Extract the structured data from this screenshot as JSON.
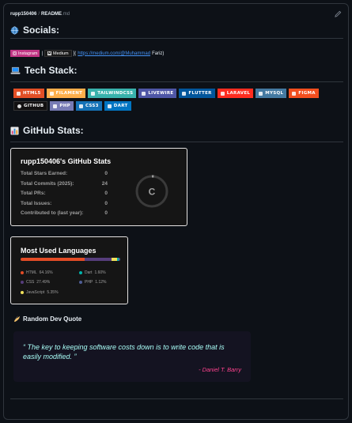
{
  "file": {
    "repo": "rupp150406",
    "separator": "/",
    "name": "README",
    "ext": ".md"
  },
  "socials": {
    "heading": "Socials:",
    "instagram_label": "Instagram",
    "separator": "|",
    "medium_label": "Medium",
    "link_prefix": "](",
    "link_text": "https://medium.com/@Muhammad",
    "link_suffix": "Fariz)"
  },
  "tech": {
    "heading": "Tech Stack:",
    "row1": [
      {
        "label": "HTML5",
        "color": "#e34f26"
      },
      {
        "label": "FILAMENT",
        "color": "#fdae4b"
      },
      {
        "label": "TAILWINDCSS",
        "color": "#38b2ac"
      },
      {
        "label": "LIVEWIRE",
        "color": "#4e56a6"
      },
      {
        "label": "FLUTTER",
        "color": "#02569b"
      },
      {
        "label": "LARAVEL",
        "color": "#ff2d20"
      },
      {
        "label": "MYSQL",
        "color": "#4479a1"
      },
      {
        "label": "FIGMA",
        "color": "#f24e1e"
      }
    ],
    "row2": [
      {
        "label": "GITHUB",
        "color": "#121011"
      },
      {
        "label": "PHP",
        "color": "#777bb4"
      },
      {
        "label": "CSS3",
        "color": "#1572b6"
      },
      {
        "label": "DART",
        "color": "#0175c2"
      }
    ]
  },
  "stats": {
    "heading": "GitHub Stats:",
    "card_title": "rupp150406's GitHub Stats",
    "rows": [
      {
        "label": "Total Stars Earned:",
        "value": "0"
      },
      {
        "label": "Total Commits (2025):",
        "value": "24"
      },
      {
        "label": "Total PRs:",
        "value": "0"
      },
      {
        "label": "Total Issues:",
        "value": "0"
      },
      {
        "label": "Contributed to (last year):",
        "value": "0"
      }
    ],
    "rank": "C",
    "rank_progress": 0.02
  },
  "languages": {
    "title": "Most Used Languages",
    "items": [
      {
        "name": "HTML",
        "percent": "64.16%",
        "value": 64.16,
        "color": "#e34c26"
      },
      {
        "name": "Dart",
        "percent": "1.60%",
        "value": 1.6,
        "color": "#00b4ab"
      },
      {
        "name": "CSS",
        "percent": "27.49%",
        "value": 27.49,
        "color": "#563d7c"
      },
      {
        "name": "PHP",
        "percent": "1.12%",
        "value": 1.12,
        "color": "#4f5d95"
      },
      {
        "name": "JavaScript",
        "percent": "5.35%",
        "value": 5.35,
        "color": "#f1e05a"
      }
    ]
  },
  "quote": {
    "heading": "Random Dev Quote",
    "text": "The key to keeping software costs down is to write code that is easily modified.",
    "author": "- Daniel T. Barry",
    "text_color": "#a9fef7",
    "author_color": "#fe428e"
  }
}
